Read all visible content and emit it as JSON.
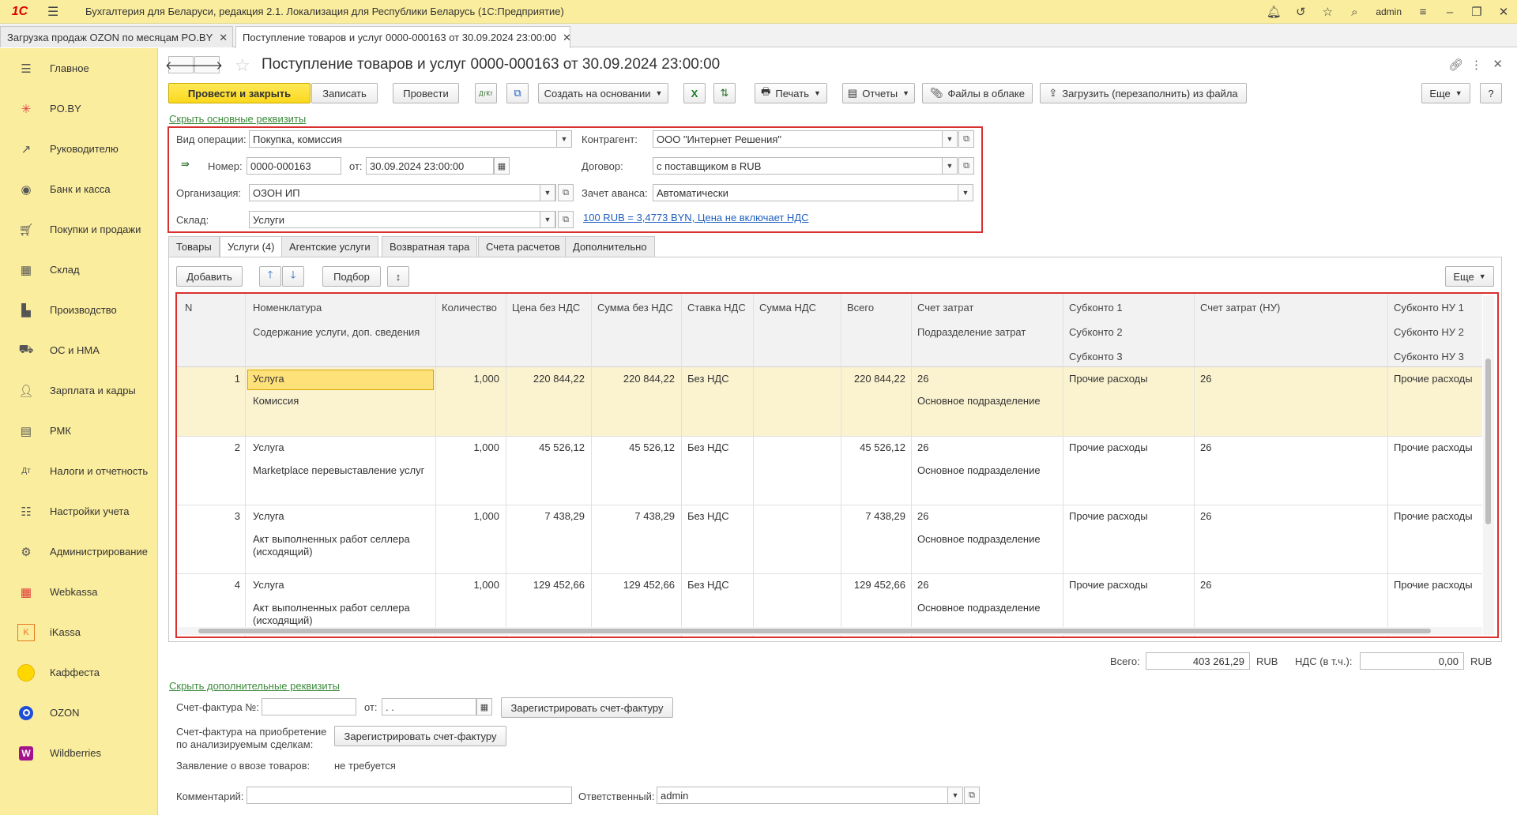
{
  "titlebar": {
    "logo": "1С",
    "title": "Бухгалтерия для Беларуси, редакция 2.1. Локализация для Республики Беларусь   (1С:Предприятие)",
    "user": "admin"
  },
  "open_tabs": [
    {
      "label": "Загрузка продаж OZON по месяцам PO.BY"
    },
    {
      "label": "Поступление товаров и услуг 0000-000163 от 30.09.2024 23:00:00"
    }
  ],
  "sidebar": {
    "items": [
      {
        "label": "Главное",
        "icon": "menu-icon"
      },
      {
        "label": "PO.BY",
        "icon": "poby-icon"
      },
      {
        "label": "Руководителю",
        "icon": "chart-icon"
      },
      {
        "label": "Банк и касса",
        "icon": "bank-icon"
      },
      {
        "label": "Покупки и продажи",
        "icon": "cart-icon"
      },
      {
        "label": "Склад",
        "icon": "warehouse-icon"
      },
      {
        "label": "Производство",
        "icon": "factory-icon"
      },
      {
        "label": "ОС и НМА",
        "icon": "truck-icon"
      },
      {
        "label": "Зарплата и кадры",
        "icon": "person-icon"
      },
      {
        "label": "РМК",
        "icon": "register-icon"
      },
      {
        "label": "Налоги и отчетность",
        "icon": "taxes-icon"
      },
      {
        "label": "Настройки учета",
        "icon": "settings-list-icon"
      },
      {
        "label": "Администрирование",
        "icon": "gear-icon"
      },
      {
        "label": "Webkassa",
        "icon": "webkassa-icon"
      },
      {
        "label": "iKassa",
        "icon": "ikassa-icon"
      },
      {
        "label": "Каффеста",
        "icon": "kaffesta-icon"
      },
      {
        "label": "OZON",
        "icon": "ozon-icon"
      },
      {
        "label": "Wildberries",
        "icon": "wildberries-icon"
      }
    ]
  },
  "document": {
    "title": "Поступление товаров и услуг 0000-000163 от 30.09.2024 23:00:00"
  },
  "toolbar": {
    "post_close": "Провести и закрыть",
    "save": "Записать",
    "post": "Провести",
    "create_based": "Создать на основании",
    "print": "Печать",
    "reports": "Отчеты",
    "cloud_files": "Файлы в облаке",
    "load": "Загрузить (перезаполнить) из файла",
    "more": "Еще",
    "help": "?",
    "dt_kt": "ДтКт"
  },
  "header": {
    "hide_main_link": "Скрыть основные реквизиты",
    "op_type_label": "Вид операции:",
    "op_type": "Покупка, комиссия",
    "number_label": "Номер:",
    "number": "0000-000163",
    "date_label": "от:",
    "date": "30.09.2024 23:00:00",
    "org_label": "Организация:",
    "org": "ОЗОН ИП",
    "warehouse_label": "Склад:",
    "warehouse": "Услуги",
    "counterparty_label": "Контрагент:",
    "counterparty": "ООО \"Интернет Решения\"",
    "contract_label": "Договор:",
    "contract": "с поставщиком в RUB",
    "advance_label": "Зачет аванса:",
    "advance": "Автоматически",
    "rate_link": "100 RUB = 3,4773 BYN, Цена не включает НДС"
  },
  "form_tabs": [
    "Товары",
    "Услуги (4)",
    "Агентские услуги",
    "Возвратная тара",
    "Счета расчетов",
    "Дополнительно"
  ],
  "services_toolbar": {
    "add": "Добавить",
    "pick": "Подбор",
    "more": "Еще"
  },
  "table": {
    "headers": {
      "n": "N",
      "nom": "Номенклатура",
      "content": "Содержание услуги, доп. сведения",
      "qty": "Количество",
      "price": "Цена без НДС",
      "sum": "Сумма без НДС",
      "vat_rate": "Ставка НДС",
      "vat_sum": "Сумма НДС",
      "total": "Всего",
      "cost_acc": "Счет затрат",
      "dept": "Подразделение затрат",
      "sub1": "Субконто 1",
      "sub2": "Субконто 2",
      "sub3": "Субконто 3",
      "cost_acc_nu": "Счет затрат (НУ)",
      "subnu1": "Субконто НУ 1",
      "subnu2": "Субконто НУ 2",
      "subnu3": "Субконто НУ 3"
    },
    "rows": [
      {
        "n": "1",
        "nom": "Услуга",
        "content": "Комиссия",
        "qty": "1,000",
        "price": "220 844,22",
        "sum": "220 844,22",
        "vat_rate": "Без НДС",
        "total": "220 844,22",
        "cost_acc": "26",
        "dept": "Основное подразделение",
        "sub1": "Прочие расходы",
        "cost_acc_nu": "26",
        "subnu1": "Прочие расходы"
      },
      {
        "n": "2",
        "nom": "Услуга",
        "content": "Marketplace перевыставление услуг",
        "qty": "1,000",
        "price": "45 526,12",
        "sum": "45 526,12",
        "vat_rate": "Без НДС",
        "total": "45 526,12",
        "cost_acc": "26",
        "dept": "Основное подразделение",
        "sub1": "Прочие расходы",
        "cost_acc_nu": "26",
        "subnu1": "Прочие расходы"
      },
      {
        "n": "3",
        "nom": "Услуга",
        "content": "Акт выполненных работ селлера (исходящий)",
        "qty": "1,000",
        "price": "7 438,29",
        "sum": "7 438,29",
        "vat_rate": "Без НДС",
        "total": "7 438,29",
        "cost_acc": "26",
        "dept": "Основное подразделение",
        "sub1": "Прочие расходы",
        "cost_acc_nu": "26",
        "subnu1": "Прочие расходы"
      },
      {
        "n": "4",
        "nom": "Услуга",
        "content": "Акт выполненных работ селлера (исходящий)",
        "qty": "1,000",
        "price": "129 452,66",
        "sum": "129 452,66",
        "vat_rate": "Без НДС",
        "total": "129 452,66",
        "cost_acc": "26",
        "dept": "Основное подразделение",
        "sub1": "Прочие расходы",
        "cost_acc_nu": "26",
        "subnu1": "Прочие расходы"
      }
    ]
  },
  "totals": {
    "total_label": "Всего:",
    "total": "403 261,29",
    "currency": "RUB",
    "vat_label": "НДС (в т.ч.):",
    "vat": "0,00",
    "vat_currency": "RUB"
  },
  "footer": {
    "hide_extra_link": "Скрыть дополнительные реквизиты",
    "invoice_label": "Счет-фактура №:",
    "invoice_from": "от:",
    "invoice_date": " .  .    ",
    "register_invoice": "Зарегистрировать счет-фактуру",
    "invoice_acq_label1": "Счет-фактура на приобретение",
    "invoice_acq_label2": "по анализируемым сделкам:",
    "register_invoice2": "Зарегистрировать счет-фактуру",
    "import_label": "Заявление о ввозе товаров:",
    "import_value": "не требуется",
    "comment_label": "Комментарий:",
    "responsible_label": "Ответственный:",
    "responsible": "admin"
  },
  "colors": {
    "accent": "#fbed9e",
    "primary_btn": "#fbd81e",
    "highlight": "#d93030",
    "selected_row": "#fbf3d0"
  }
}
